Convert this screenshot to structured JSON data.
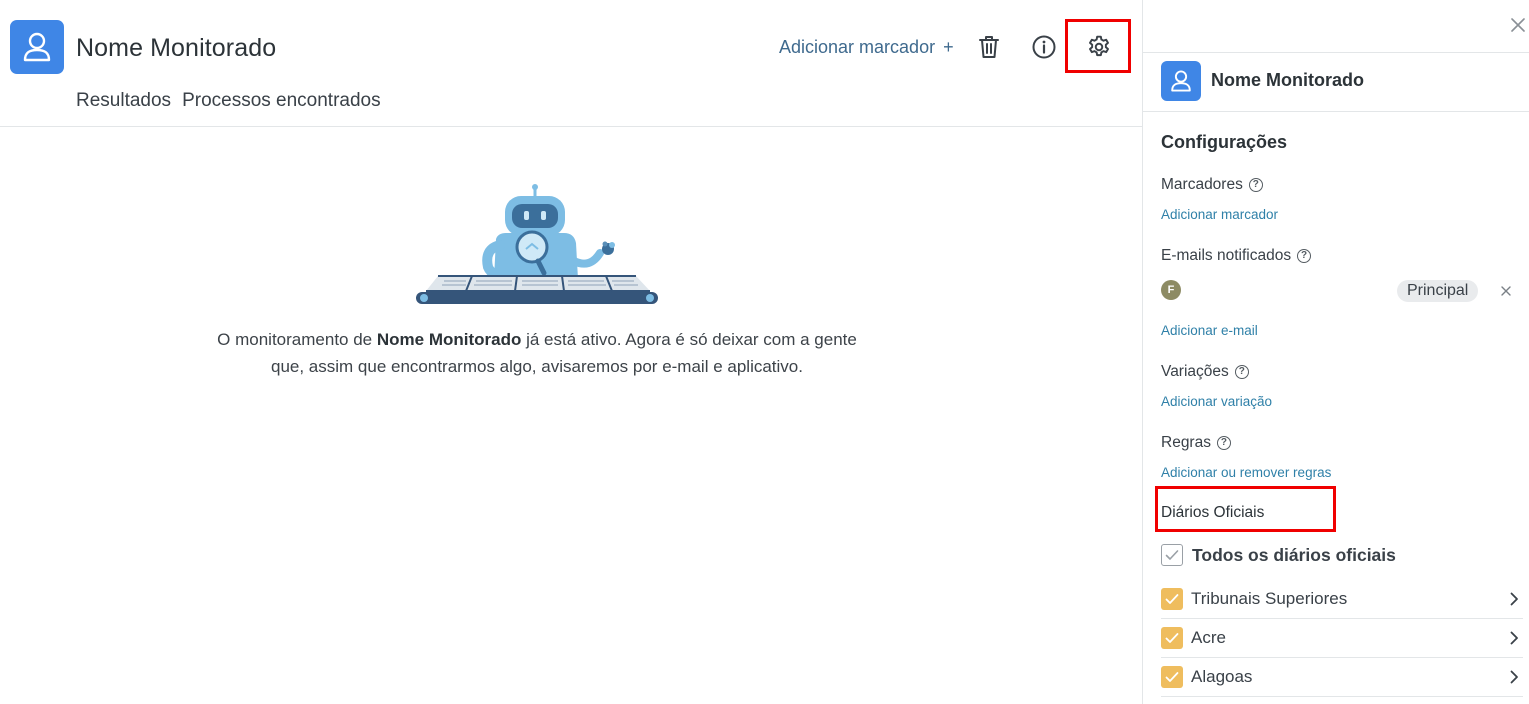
{
  "header": {
    "title": "Nome Monitorado",
    "add_marker_label": "Adicionar marcador",
    "add_marker_plus": "+"
  },
  "tabs": [
    {
      "label": "Resultados"
    },
    {
      "label": "Processos encontrados"
    }
  ],
  "empty_state": {
    "text_before": "O monitoramento de ",
    "name": "Nome Monitorado",
    "text_after": " já está ativo. Agora é só deixar com a gente que, assim que encontrarmos algo, avisaremos por e-mail e aplicativo."
  },
  "panel": {
    "name": "Nome Monitorado",
    "section_title": "Configurações",
    "marcadores": {
      "label": "Marcadores",
      "help": "?",
      "link": "Adicionar marcador"
    },
    "emails": {
      "label": "E-mails notificados",
      "help": "?",
      "list": [
        {
          "initial": "F",
          "badge": "Principal"
        }
      ],
      "link": "Adicionar e-mail"
    },
    "variacoes": {
      "label": "Variações",
      "help": "?",
      "link": "Adicionar variação"
    },
    "regras": {
      "label": "Regras",
      "help": "?",
      "link": "Adicionar ou remover regras"
    },
    "diarios": {
      "label": "Diários Oficiais",
      "all_label": "Todos os diários oficiais",
      "items": [
        {
          "label": "Tribunais Superiores"
        },
        {
          "label": "Acre"
        },
        {
          "label": "Alagoas"
        }
      ]
    }
  },
  "colors": {
    "brand_blue": "#3f86e6",
    "link_blue": "#2f80a8",
    "checkbox_yellow": "#efbd5e",
    "highlight_red": "#f00000"
  }
}
